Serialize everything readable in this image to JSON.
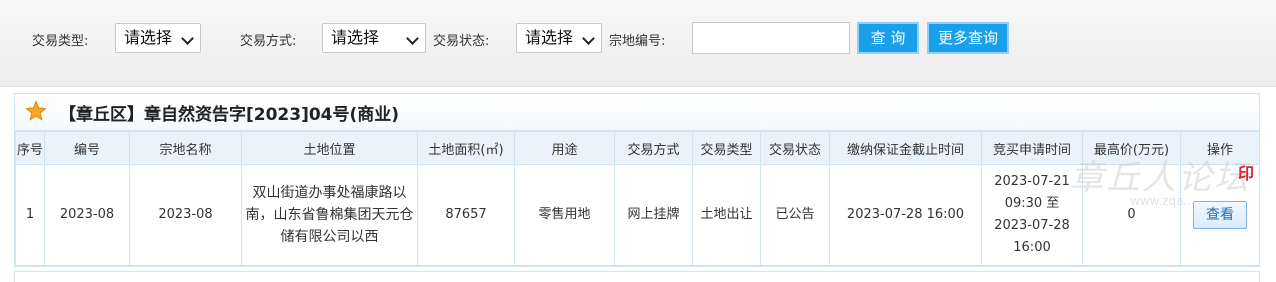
{
  "filters": {
    "trade_type_label": "交易类型:",
    "trade_type_value": "请选择",
    "trade_method_label": "交易方式:",
    "trade_method_value": "请选择",
    "trade_status_label": "交易状态:",
    "trade_status_value": "请选择",
    "parcel_no_label": "宗地编号:",
    "parcel_no_value": "",
    "search_button": "查 询",
    "more_button": "更多查询"
  },
  "announcement": {
    "title": "【章丘区】章自然资告字[2023]04号(商业)",
    "star_icon": "star-icon",
    "star_color": "#f5a623"
  },
  "table": {
    "headers": [
      "序号",
      "编号",
      "宗地名称",
      "土地位置",
      "土地面积(㎡)",
      "用途",
      "交易方式",
      "交易类型",
      "交易状态",
      "缴纳保证金截止时间",
      "竞买申请时间",
      "最高价(万元)",
      "操作"
    ],
    "rows": [
      {
        "index": "1",
        "code": "2023-08",
        "name": "2023-08",
        "location": "双山街道办事处福康路以南，山东省鲁棉集团天元仓储有限公司以西",
        "area": "87657",
        "usage": "零售用地",
        "method": "网上挂牌",
        "type": "土地出让",
        "status": "已公告",
        "deposit_deadline": "2023-07-28 16:00",
        "apply_time": "2023-07-21 09:30 至 2023-07-28 16:00",
        "highest_price": "0",
        "action": "查看"
      }
    ]
  },
  "colors": {
    "button_blue": "#1aa0e8",
    "header_bg": "#eaf3fb",
    "border": "#cfe3f0"
  }
}
